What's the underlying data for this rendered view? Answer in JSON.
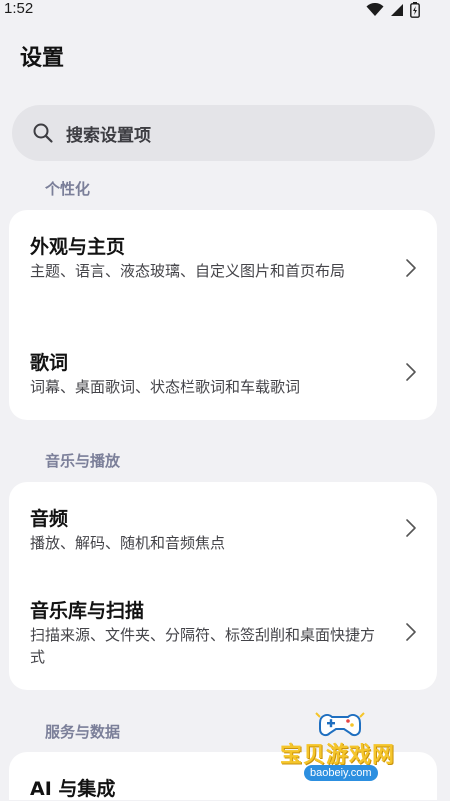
{
  "status_bar": {
    "time": "1:52"
  },
  "header": {
    "title": "设置"
  },
  "search": {
    "placeholder": "搜索设置项"
  },
  "sections": [
    {
      "header": "个性化",
      "items": [
        {
          "title": "外观与主页",
          "subtitle": "主题、语言、液态玻璃、自定义图片和首页布局"
        },
        {
          "title": "歌词",
          "subtitle": "词幕、桌面歌词、状态栏歌词和车载歌词"
        }
      ]
    },
    {
      "header": "音乐与播放",
      "items": [
        {
          "title": "音频",
          "subtitle": "播放、解码、随机和音频焦点"
        },
        {
          "title": "音乐库与扫描",
          "subtitle": "扫描来源、文件夹、分隔符、标签刮削和桌面快捷方式"
        }
      ]
    },
    {
      "header": "服务与数据",
      "items": [
        {
          "title": "AI 与集成",
          "subtitle": ""
        }
      ]
    }
  ],
  "watermark": {
    "text": "宝贝游戏网",
    "url": "baobeiy.com"
  },
  "colors": {
    "background": "#f1f1f4",
    "card": "#ffffff",
    "section_header": "#7b7f99",
    "search_bg": "#e4e4e8"
  },
  "icons": {
    "wifi": "wifi-icon",
    "signal": "signal-icon",
    "battery": "battery-charging-icon",
    "search": "search-icon",
    "chevron": "chevron-right-icon"
  }
}
